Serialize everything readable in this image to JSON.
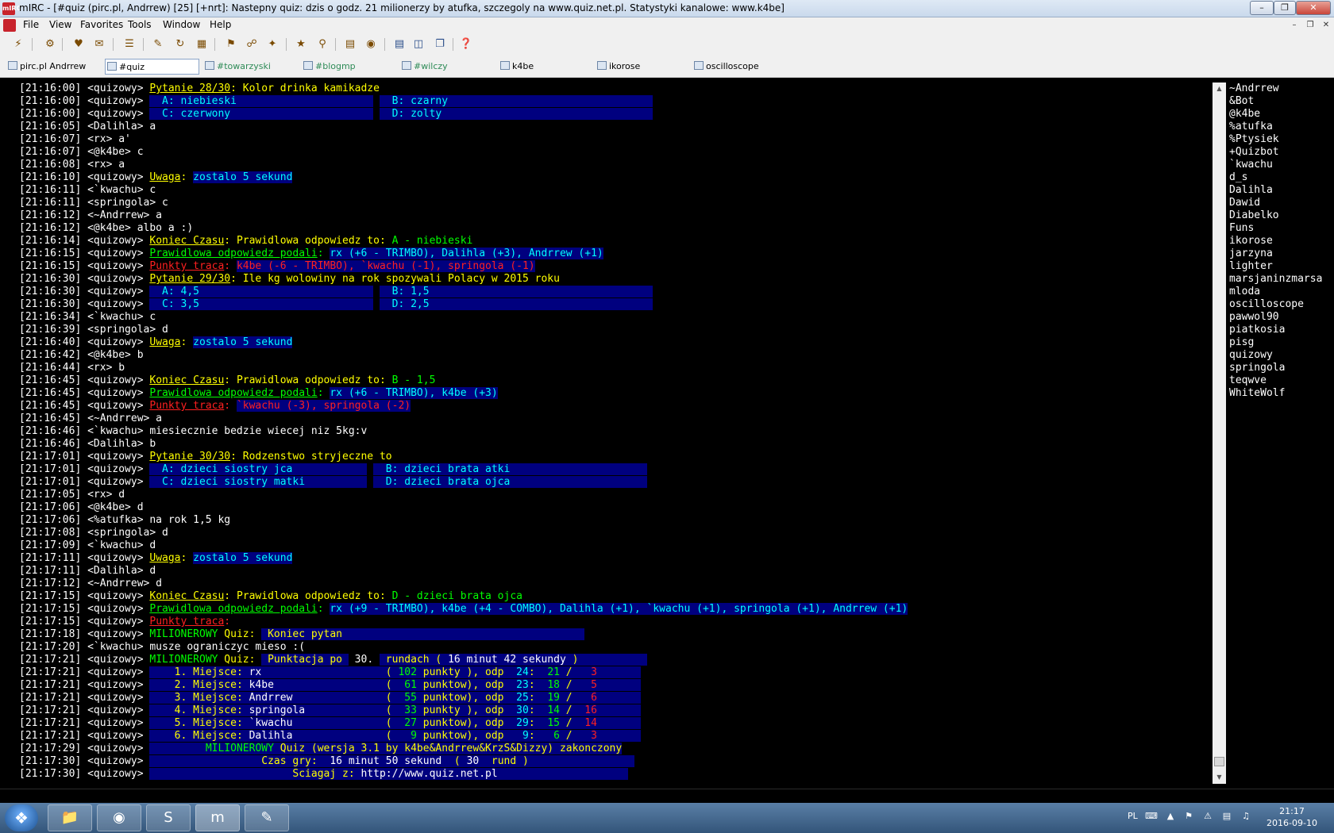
{
  "window": {
    "title": "mIRC - [#quiz (pirc.pl, Andrrew) [25] [+nrt]: Nastepny quiz: dzis o godz. 21 milionerzy by atufka, szczegoly na www.quiz.net.pl. Statystyki kanalowe: www.k4be]",
    "app_icon_text": "mIRC"
  },
  "menu": [
    "File",
    "View",
    "Favorites",
    "Tools",
    "Window",
    "Help"
  ],
  "toolbar_icons": [
    "connect-icon",
    "options-icon",
    "favorites-icon",
    "address-book-icon",
    "channels-list-icon",
    "scripts-icon",
    "dcc-send-icon",
    "dcc-chat-icon",
    "notify-icon",
    "url-list-icon",
    "colors-icon",
    "logs-icon",
    "browse-icon",
    "received-icon",
    "tile-horizontal-icon",
    "tile-vertical-icon",
    "cascade-icon",
    "help-icon"
  ],
  "switchbar": [
    {
      "label": "pirc.pl Andrrew",
      "color": "#000000",
      "active": false
    },
    {
      "label": "#quiz",
      "color": "#000000",
      "active": true
    },
    {
      "label": "#towarzyski",
      "color": "#2e8b57",
      "active": false
    },
    {
      "label": "#blogmp",
      "color": "#2e8b57",
      "active": false
    },
    {
      "label": "#wilczy",
      "color": "#2e8b57",
      "active": false
    },
    {
      "label": "k4be",
      "color": "#000000",
      "active": false
    },
    {
      "label": "ikorose",
      "color": "#000000",
      "active": false
    },
    {
      "label": "oscilloscope",
      "color": "#000000",
      "active": false
    }
  ],
  "chat_lines": [
    [
      {
        "t": "[21:16:00] <quizowy> "
      },
      {
        "t": "Pytanie 28/30",
        "c": "yellow u"
      },
      {
        "t": ": Kolor drinka kamikadze",
        "c": "yellow"
      }
    ],
    [
      {
        "t": "[21:16:00] <quizowy> "
      },
      {
        "t": "  A: niebieski                      ",
        "c": "cyan hl"
      },
      {
        "t": " "
      },
      {
        "t": "  B: czarny                                 ",
        "c": "cyan hl"
      }
    ],
    [
      {
        "t": "[21:16:00] <quizowy> "
      },
      {
        "t": "  C: czerwony                       ",
        "c": "cyan hl"
      },
      {
        "t": " "
      },
      {
        "t": "  D: zolty                                  ",
        "c": "cyan hl"
      }
    ],
    [
      {
        "t": "[21:16:05] <Dalihla> a"
      }
    ],
    [
      {
        "t": "[21:16:07] <rx> a'"
      }
    ],
    [
      {
        "t": "[21:16:07] <@k4be> c"
      }
    ],
    [
      {
        "t": "[21:16:08] <rx> a"
      }
    ],
    [
      {
        "t": "[21:16:10] <quizowy> "
      },
      {
        "t": "Uwaga",
        "c": "yellow u"
      },
      {
        "t": ": ",
        "c": "yellow"
      },
      {
        "t": "zostalo 5 sekund",
        "c": "cyan hl"
      }
    ],
    [
      {
        "t": "[21:16:11] <`kwachu> c"
      }
    ],
    [
      {
        "t": "[21:16:11] <springola> c"
      }
    ],
    [
      {
        "t": "[21:16:12] <~Andrrew> a"
      }
    ],
    [
      {
        "t": "[21:16:12] <@k4be> albo a :)"
      }
    ],
    [
      {
        "t": "[21:16:14] <quizowy> "
      },
      {
        "t": "Koniec Czasu",
        "c": "yellow u"
      },
      {
        "t": ": Prawidlowa odpowiedz to: ",
        "c": "yellow"
      },
      {
        "t": "A - niebieski",
        "c": "green"
      }
    ],
    [
      {
        "t": "[21:16:15] <quizowy> "
      },
      {
        "t": "Prawidlowa odpowiedz podali",
        "c": "green u"
      },
      {
        "t": ": ",
        "c": "green"
      },
      {
        "t": "rx (+6 - TRIMBO), Dalihla (+3), Andrrew (+1)",
        "c": "cyan hl"
      }
    ],
    [
      {
        "t": "[21:16:15] <quizowy> "
      },
      {
        "t": "Punkty traca",
        "c": "red u"
      },
      {
        "t": ": ",
        "c": "red"
      },
      {
        "t": "k4be (-6 - TRIMBO), `kwachu (-1), springola (-1)",
        "c": "red hl"
      }
    ],
    [
      {
        "t": "[21:16:30] <quizowy> "
      },
      {
        "t": "Pytanie 29/30",
        "c": "yellow u"
      },
      {
        "t": ": Ile kg wolowiny na rok spozywali Polacy w 2015 roku",
        "c": "yellow"
      }
    ],
    [
      {
        "t": "[21:16:30] <quizowy> "
      },
      {
        "t": "  A: 4,5                            ",
        "c": "cyan hl"
      },
      {
        "t": " "
      },
      {
        "t": "  B: 1,5                                    ",
        "c": "cyan hl"
      }
    ],
    [
      {
        "t": "[21:16:30] <quizowy> "
      },
      {
        "t": "  C: 3,5                            ",
        "c": "cyan hl"
      },
      {
        "t": " "
      },
      {
        "t": "  D: 2,5                                    ",
        "c": "cyan hl"
      }
    ],
    [
      {
        "t": "[21:16:34] <`kwachu> c"
      }
    ],
    [
      {
        "t": "[21:16:39] <springola> d"
      }
    ],
    [
      {
        "t": "[21:16:40] <quizowy> "
      },
      {
        "t": "Uwaga",
        "c": "yellow u"
      },
      {
        "t": ": ",
        "c": "yellow"
      },
      {
        "t": "zostalo 5 sekund",
        "c": "cyan hl"
      }
    ],
    [
      {
        "t": "[21:16:42] <@k4be> b"
      }
    ],
    [
      {
        "t": "[21:16:44] <rx> b"
      }
    ],
    [
      {
        "t": "[21:16:45] <quizowy> "
      },
      {
        "t": "Koniec Czasu",
        "c": "yellow u"
      },
      {
        "t": ": Prawidlowa odpowiedz to: ",
        "c": "yellow"
      },
      {
        "t": "B - 1,5",
        "c": "green"
      }
    ],
    [
      {
        "t": "[21:16:45] <quizowy> "
      },
      {
        "t": "Prawidlowa odpowiedz podali",
        "c": "green u"
      },
      {
        "t": ": ",
        "c": "green"
      },
      {
        "t": "rx (+6 - TRIMBO), k4be (+3)",
        "c": "cyan hl"
      }
    ],
    [
      {
        "t": "[21:16:45] <quizowy> "
      },
      {
        "t": "Punkty traca",
        "c": "red u"
      },
      {
        "t": ": ",
        "c": "red"
      },
      {
        "t": "`kwachu (-3), springola (-2)",
        "c": "red hl"
      }
    ],
    [
      {
        "t": "[21:16:45] <~Andrrew> a"
      }
    ],
    [
      {
        "t": "[21:16:46] <`kwachu> miesiecznie bedzie wiecej niz 5kg:v"
      }
    ],
    [
      {
        "t": "[21:16:46] <Dalihla> b"
      }
    ],
    [
      {
        "t": "[21:17:01] <quizowy> "
      },
      {
        "t": "Pytanie 30/30",
        "c": "yellow u"
      },
      {
        "t": ": Rodzenstwo stryjeczne to",
        "c": "yellow"
      }
    ],
    [
      {
        "t": "[21:17:01] <quizowy> "
      },
      {
        "t": "  A: dzieci siostry jca            ",
        "c": "cyan hl"
      },
      {
        "t": " "
      },
      {
        "t": "  B: dzieci brata atki                      ",
        "c": "cyan hl"
      }
    ],
    [
      {
        "t": "[21:17:01] <quizowy> "
      },
      {
        "t": "  C: dzieci siostry matki          ",
        "c": "cyan hl"
      },
      {
        "t": " "
      },
      {
        "t": "  D: dzieci brata ojca                      ",
        "c": "cyan hl"
      }
    ],
    [
      {
        "t": "[21:17:05] <rx> d"
      }
    ],
    [
      {
        "t": "[21:17:06] <@k4be> d"
      }
    ],
    [
      {
        "t": "[21:17:06] <%atufka> na rok 1,5 kg"
      }
    ],
    [
      {
        "t": "[21:17:08] <springola> d"
      }
    ],
    [
      {
        "t": "[21:17:09] <`kwachu> d"
      }
    ],
    [
      {
        "t": "[21:17:11] <quizowy> "
      },
      {
        "t": "Uwaga",
        "c": "yellow u"
      },
      {
        "t": ": ",
        "c": "yellow"
      },
      {
        "t": "zostalo 5 sekund",
        "c": "cyan hl"
      }
    ],
    [
      {
        "t": "[21:17:11] <Dalihla> d"
      }
    ],
    [
      {
        "t": "[21:17:12] <~Andrrew> d"
      }
    ],
    [
      {
        "t": "[21:17:15] <quizowy> "
      },
      {
        "t": "Koniec Czasu",
        "c": "yellow u"
      },
      {
        "t": ": Prawidlowa odpowiedz to: ",
        "c": "yellow"
      },
      {
        "t": "D - dzieci brata ojca",
        "c": "green"
      }
    ],
    [
      {
        "t": "[21:17:15] <quizowy> "
      },
      {
        "t": "Prawidlowa odpowiedz podali",
        "c": "green u"
      },
      {
        "t": ": ",
        "c": "green"
      },
      {
        "t": "rx (+9 - TRIMBO), k4be (+4 - COMBO), Dalihla (+1), `kwachu (+1), springola (+1), Andrrew (+1)",
        "c": "cyan hl"
      }
    ],
    [
      {
        "t": "[21:17:15] <quizowy> "
      },
      {
        "t": "Punkty traca",
        "c": "red u"
      },
      {
        "t": ":",
        "c": "red"
      }
    ],
    [
      {
        "t": "[21:17:18] <quizowy> "
      },
      {
        "t": "MILIONEROWY",
        "c": "green"
      },
      {
        "t": " Quiz: ",
        "c": "yellow"
      },
      {
        "t": " Koniec pytan                                       ",
        "c": "yellow hl"
      }
    ],
    [
      {
        "t": "[21:17:20] <`kwachu> musze ograniczyc mieso :("
      }
    ],
    [
      {
        "t": "[21:17:21] <quizowy> "
      },
      {
        "t": "MILIONEROWY",
        "c": "green"
      },
      {
        "t": " Quiz: ",
        "c": "yellow"
      },
      {
        "t": " Punktacja po ",
        "c": "yellow hl"
      },
      {
        "t": " 30. ",
        "c": "white"
      },
      {
        "t": " rundach ( ",
        "c": "yellow hl"
      },
      {
        "t": "16 minut 42 sekundy",
        "c": "white hl"
      },
      {
        "t": " )           ",
        "c": "yellow hl"
      }
    ],
    [
      {
        "t": "[21:17:21] <quizowy> "
      },
      {
        "t": "    1. Miejsce: ",
        "c": "yellow hl"
      },
      {
        "t": "rx                    ",
        "c": "white hl"
      },
      {
        "t": "( ",
        "c": "yellow hl"
      },
      {
        "t": "102",
        "c": "green hl"
      },
      {
        "t": " punkty ), odp  ",
        "c": "yellow hl"
      },
      {
        "t": "24",
        "c": "cyan hl"
      },
      {
        "t": ":  ",
        "c": "yellow hl"
      },
      {
        "t": "21",
        "c": "green hl"
      },
      {
        "t": " /   ",
        "c": "yellow hl"
      },
      {
        "t": "3",
        "c": "red hl"
      },
      {
        "t": "       ",
        "c": "hl"
      }
    ],
    [
      {
        "t": "[21:17:21] <quizowy> "
      },
      {
        "t": "    2. Miejsce: ",
        "c": "yellow hl"
      },
      {
        "t": "k4be                  ",
        "c": "white hl"
      },
      {
        "t": "(  ",
        "c": "yellow hl"
      },
      {
        "t": "61",
        "c": "green hl"
      },
      {
        "t": " punktow), odp  ",
        "c": "yellow hl"
      },
      {
        "t": "23",
        "c": "cyan hl"
      },
      {
        "t": ":  ",
        "c": "yellow hl"
      },
      {
        "t": "18",
        "c": "green hl"
      },
      {
        "t": " /   ",
        "c": "yellow hl"
      },
      {
        "t": "5",
        "c": "red hl"
      },
      {
        "t": "       ",
        "c": "hl"
      }
    ],
    [
      {
        "t": "[21:17:21] <quizowy> "
      },
      {
        "t": "    3. Miejsce: ",
        "c": "yellow hl"
      },
      {
        "t": "Andrrew               ",
        "c": "white hl"
      },
      {
        "t": "(  ",
        "c": "yellow hl"
      },
      {
        "t": "55",
        "c": "green hl"
      },
      {
        "t": " punktow), odp  ",
        "c": "yellow hl"
      },
      {
        "t": "25",
        "c": "cyan hl"
      },
      {
        "t": ":  ",
        "c": "yellow hl"
      },
      {
        "t": "19",
        "c": "green hl"
      },
      {
        "t": " /   ",
        "c": "yellow hl"
      },
      {
        "t": "6",
        "c": "red hl"
      },
      {
        "t": "       ",
        "c": "hl"
      }
    ],
    [
      {
        "t": "[21:17:21] <quizowy> "
      },
      {
        "t": "    4. Miejsce: ",
        "c": "yellow hl"
      },
      {
        "t": "springola             ",
        "c": "white hl"
      },
      {
        "t": "(  ",
        "c": "yellow hl"
      },
      {
        "t": "33",
        "c": "green hl"
      },
      {
        "t": " punkty ), odp  ",
        "c": "yellow hl"
      },
      {
        "t": "30",
        "c": "cyan hl"
      },
      {
        "t": ":  ",
        "c": "yellow hl"
      },
      {
        "t": "14",
        "c": "green hl"
      },
      {
        "t": " /  ",
        "c": "yellow hl"
      },
      {
        "t": "16",
        "c": "red hl"
      },
      {
        "t": "       ",
        "c": "hl"
      }
    ],
    [
      {
        "t": "[21:17:21] <quizowy> "
      },
      {
        "t": "    5. Miejsce: ",
        "c": "yellow hl"
      },
      {
        "t": "`kwachu               ",
        "c": "white hl"
      },
      {
        "t": "(  ",
        "c": "yellow hl"
      },
      {
        "t": "27",
        "c": "green hl"
      },
      {
        "t": " punktow), odp  ",
        "c": "yellow hl"
      },
      {
        "t": "29",
        "c": "cyan hl"
      },
      {
        "t": ":  ",
        "c": "yellow hl"
      },
      {
        "t": "15",
        "c": "green hl"
      },
      {
        "t": " /  ",
        "c": "yellow hl"
      },
      {
        "t": "14",
        "c": "red hl"
      },
      {
        "t": "       ",
        "c": "hl"
      }
    ],
    [
      {
        "t": "[21:17:21] <quizowy> "
      },
      {
        "t": "    6. Miejsce: ",
        "c": "yellow hl"
      },
      {
        "t": "Dalihla               ",
        "c": "white hl"
      },
      {
        "t": "(   ",
        "c": "yellow hl"
      },
      {
        "t": "9",
        "c": "green hl"
      },
      {
        "t": " punktow), odp   ",
        "c": "yellow hl"
      },
      {
        "t": "9",
        "c": "cyan hl"
      },
      {
        "t": ":   ",
        "c": "yellow hl"
      },
      {
        "t": "6",
        "c": "green hl"
      },
      {
        "t": " /   ",
        "c": "yellow hl"
      },
      {
        "t": "3",
        "c": "red hl"
      },
      {
        "t": "       ",
        "c": "hl"
      }
    ],
    [
      {
        "t": "[21:17:29] <quizowy> "
      },
      {
        "t": "         ",
        "c": "hl"
      },
      {
        "t": "MILIONEROWY",
        "c": "green hl"
      },
      {
        "t": " Quiz (wersja 3.1 by k4be&Andrrew&KrzS&Dizzy) zakonczony",
        "c": "yellow hl"
      }
    ],
    [
      {
        "t": "[21:17:30] <quizowy> "
      },
      {
        "t": "                  Czas gry:  ",
        "c": "yellow hl"
      },
      {
        "t": "16 minut 50 sekund",
        "c": "white hl"
      },
      {
        "t": "  ( ",
        "c": "yellow hl"
      },
      {
        "t": "30",
        "c": "white hl"
      },
      {
        "t": "  rund )                 ",
        "c": "yellow hl"
      }
    ],
    [
      {
        "t": "[21:17:30] <quizowy> "
      },
      {
        "t": "                       Sciagaj z: ",
        "c": "yellow hl"
      },
      {
        "t": "http://www.quiz.net.pl",
        "c": "white hl"
      },
      {
        "t": "                     ",
        "c": "hl"
      }
    ]
  ],
  "nicklist": [
    "~Andrrew",
    "&Bot",
    "@k4be",
    "%atufka",
    "%Ptysiek",
    "+Quizbot",
    "`kwachu",
    "d_s",
    "Dalihla",
    "Dawid",
    "Diabelko",
    "Funs",
    "ikorose",
    "jarzyna",
    "lighter",
    "marsjaninzmarsa",
    "mloda",
    "oscilloscope",
    "pawwol90",
    "piatkosia",
    "pisg",
    "quizowy",
    "springola",
    "teqwve",
    "WhiteWolf"
  ],
  "taskbar": {
    "apps": [
      "explorer-icon",
      "firefox-icon",
      "skype-icon",
      "mirc-icon",
      "paint-icon"
    ],
    "language": "PL",
    "time": "21:17",
    "date": "2016-09-10"
  }
}
